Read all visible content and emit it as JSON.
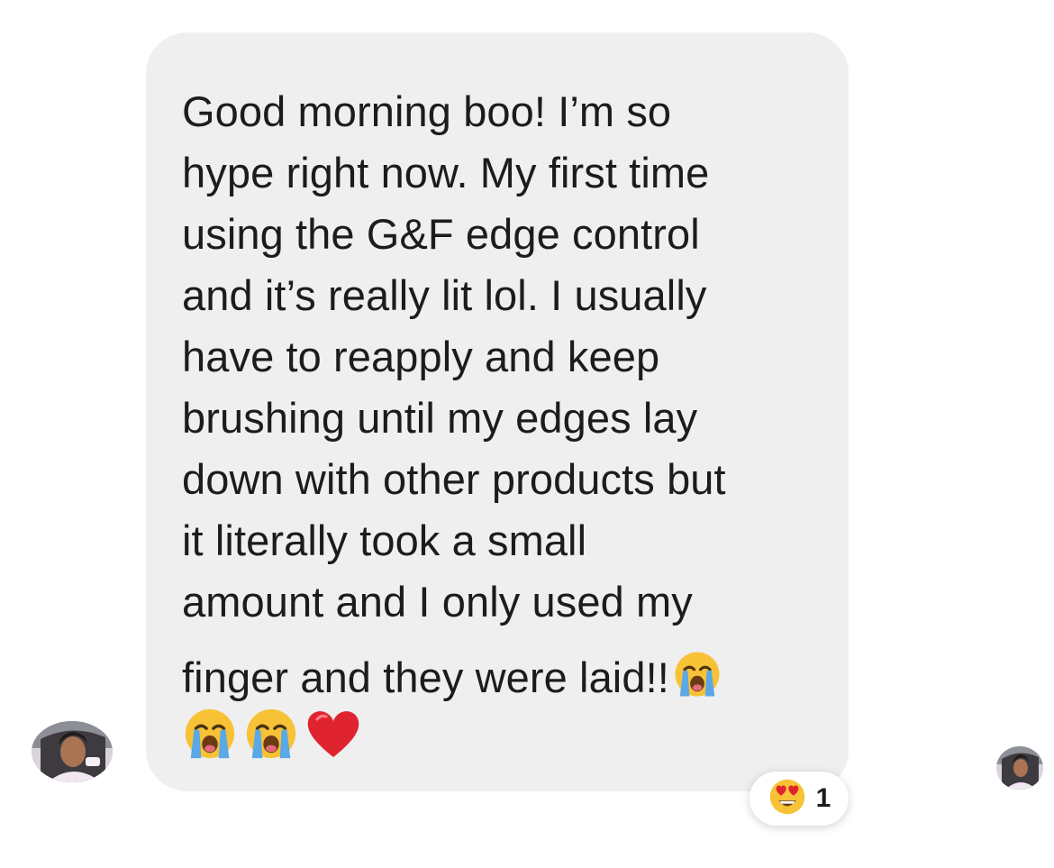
{
  "message": {
    "lines": [
      "Good morning boo! I’m so",
      "hype right now. My first time",
      "using the G&F edge control",
      "and it’s really lit lol. I usually",
      "have to reapply and keep",
      "brushing until my edges lay",
      "down with other products but",
      "it literally took a small",
      "amount and I only used my",
      "finger and they were laid!!"
    ],
    "inline_emoji": "crying-face",
    "trailing_emojis": [
      "crying-face",
      "crying-face",
      "red-heart"
    ]
  },
  "reaction": {
    "emoji": "heart-eyes-face",
    "count": "1"
  },
  "avatars": {
    "sender": "profile-photo",
    "read_receipt": "profile-photo"
  },
  "colors": {
    "bubble_background": "#efeff0",
    "text": "#1c1c1e",
    "emoji_yellow": "#f7c236",
    "tears_blue": "#5aa8e6",
    "heart_red": "#e0242f"
  }
}
